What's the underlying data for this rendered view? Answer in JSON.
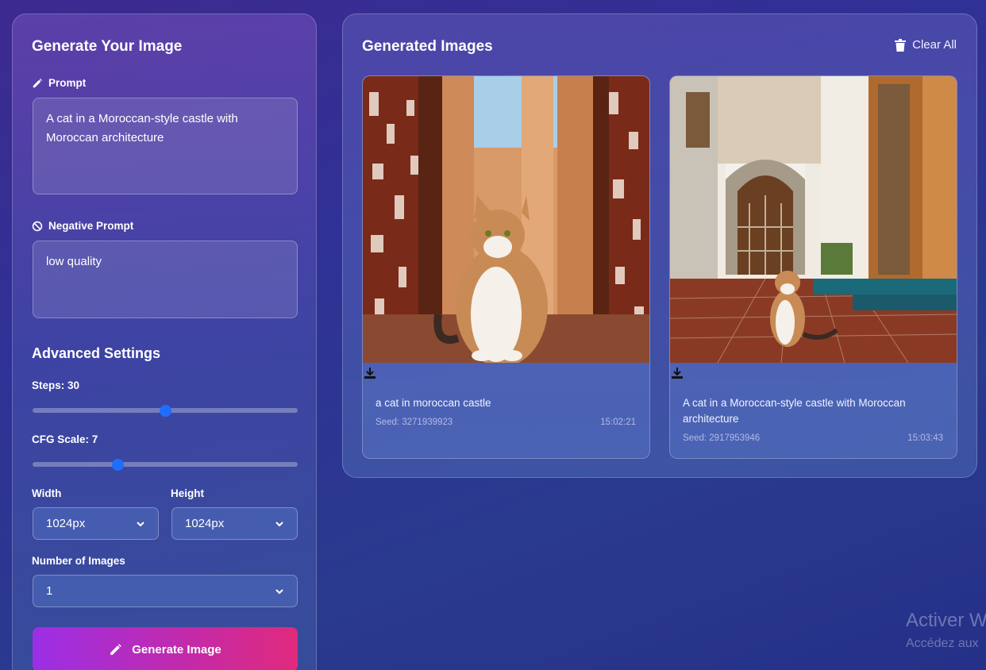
{
  "left_panel": {
    "title": "Generate Your Image",
    "prompt_label": "Prompt",
    "prompt_value": "A cat in a Moroccan-style castle with Moroccan architecture",
    "negative_label": "Negative Prompt",
    "negative_value": "low quality",
    "advanced_title": "Advanced Settings",
    "steps_label": "Steps: 30",
    "steps_fraction": 0.5,
    "cfg_label": "CFG Scale: 7",
    "cfg_fraction": 0.32,
    "width_label": "Width",
    "width_value": "1024px",
    "height_label": "Height",
    "height_value": "1024px",
    "num_images_label": "Number of Images",
    "num_images_value": "1",
    "generate_label": "Generate Image"
  },
  "right_panel": {
    "title": "Generated Images",
    "clear_label": "Clear All",
    "cards": [
      {
        "caption": "a cat in moroccan castle",
        "seed": "Seed: 3271939923",
        "time": "15:02:21"
      },
      {
        "caption": "A cat in a Moroccan-style castle with Moroccan architecture",
        "seed": "Seed: 2917953946",
        "time": "15:03:43"
      }
    ]
  },
  "watermark": {
    "line1": "Activer W",
    "line2": "Accédez aux"
  },
  "colors": {
    "accent_blue": "#1e6fff",
    "button_start": "#9b2fe6",
    "button_end": "#e02a7c"
  }
}
